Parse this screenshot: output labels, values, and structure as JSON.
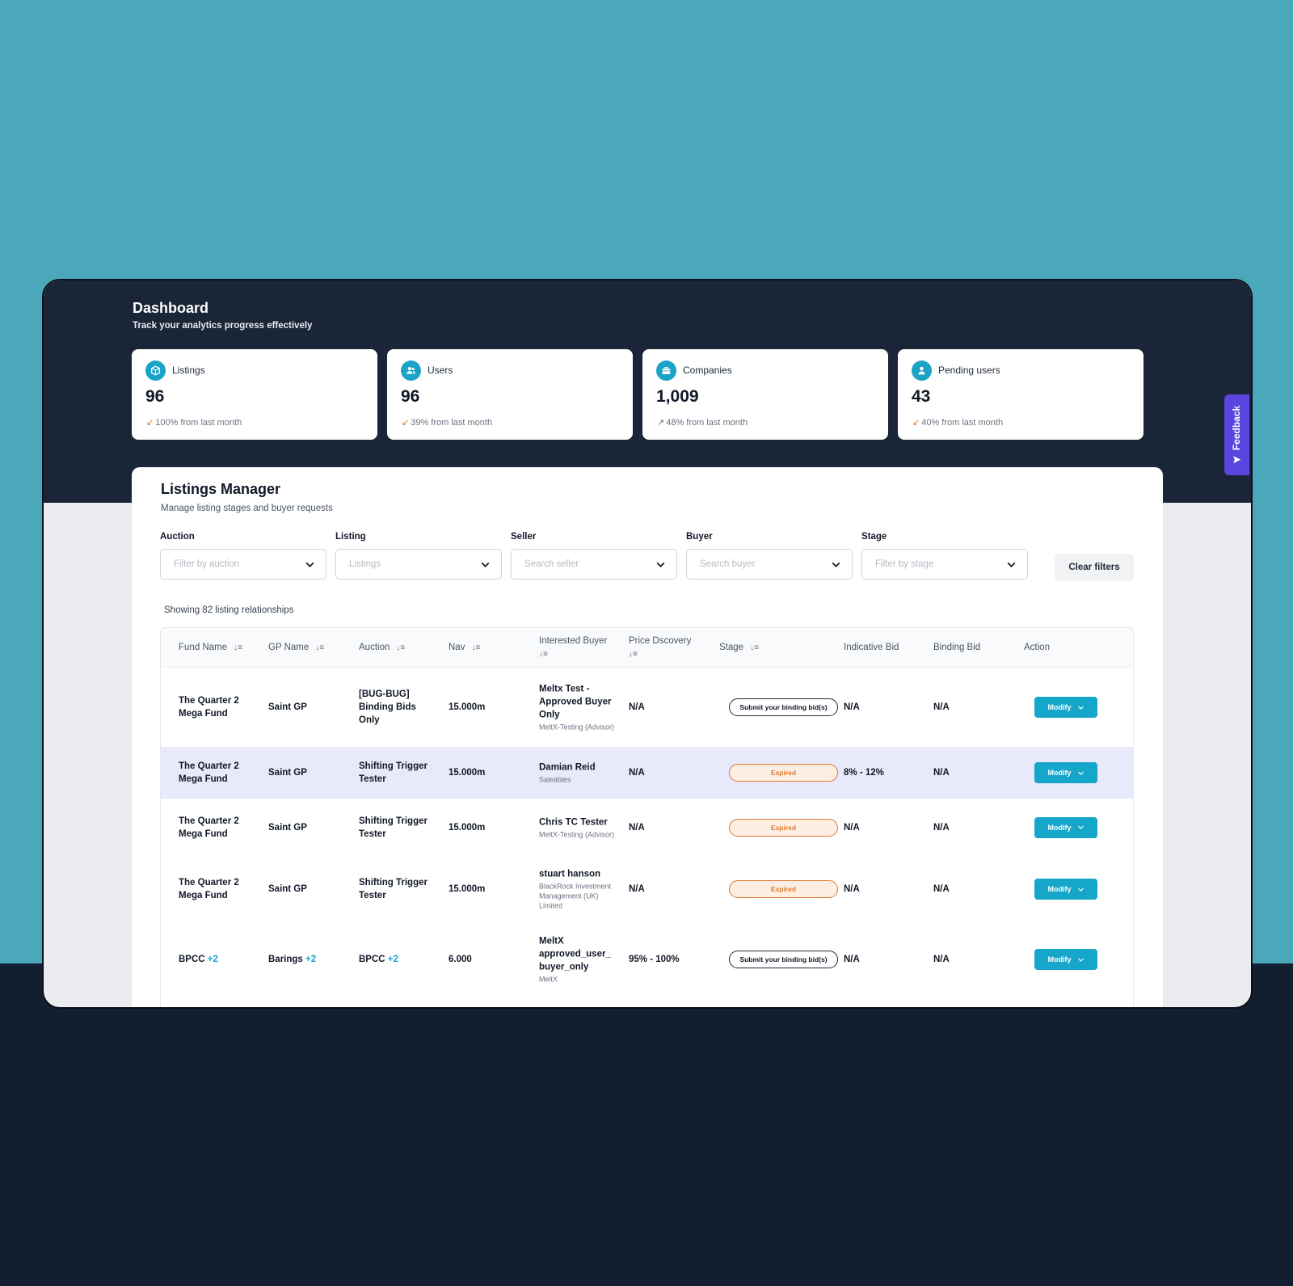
{
  "header": {
    "title": "Dashboard",
    "subtitle": "Track your analytics progress effectively"
  },
  "stats": [
    {
      "label": "Listings",
      "value": "96",
      "change": "100% from last month",
      "trend": "down",
      "icon": "box-icon"
    },
    {
      "label": "Users",
      "value": "96",
      "change": "39% from last month",
      "trend": "down",
      "icon": "users-icon"
    },
    {
      "label": "Companies",
      "value": "1,009",
      "change": "48% from last month",
      "trend": "up",
      "icon": "briefcase-icon"
    },
    {
      "label": "Pending users",
      "value": "43",
      "change": "40% from last month",
      "trend": "down",
      "icon": "user-icon"
    }
  ],
  "manager": {
    "title": "Listings Manager",
    "subtitle": "Manage listing stages and buyer requests",
    "filters": [
      {
        "label": "Auction",
        "placeholder": "Filter by auction"
      },
      {
        "label": "Listing",
        "placeholder": "Listings"
      },
      {
        "label": "Seller",
        "placeholder": "Search seller"
      },
      {
        "label": "Buyer",
        "placeholder": "Search buyer"
      },
      {
        "label": "Stage",
        "placeholder": "Filter by stage"
      }
    ],
    "clear_label": "Clear filters",
    "showing": "Showing 82 listing relationships"
  },
  "table": {
    "columns": {
      "fund_name": "Fund Name",
      "gp_name": "GP Name",
      "auction": "Auction",
      "nav": "Nav",
      "interested_buyer": "Interested Buyer",
      "price_discovery": "Price Dscovery",
      "stage": "Stage",
      "indicative_bid": "Indicative Bid",
      "binding_bid": "Binding Bid",
      "action": "Action"
    },
    "rows": [
      {
        "fund": "The Quarter 2 Mega Fund",
        "gp": "Saint GP",
        "auction": "[BUG-BUG] Binding Bids Only",
        "nav": "15.000m",
        "buyer": "Meltx Test - Approved Buyer Only",
        "buyer_org": "MeltX-Testing (Advisor)",
        "price": "N/A",
        "stage": "Submit your binding bid(s)",
        "indicative": "N/A",
        "binding": "N/A",
        "action": "Modify"
      },
      {
        "fund": "The Quarter 2 Mega Fund",
        "gp": "Saint GP",
        "auction": "Shifting Trigger Tester",
        "nav": "15.000m",
        "buyer": "Damian Reid",
        "buyer_org": "Saleables",
        "price": "N/A",
        "stage": "Expired",
        "indicative": "8% - 12%",
        "binding": "N/A",
        "action": "Modify"
      },
      {
        "fund": "The Quarter 2 Mega Fund",
        "gp": "Saint GP",
        "auction": "Shifting Trigger Tester",
        "nav": "15.000m",
        "buyer": "Chris TC Tester",
        "buyer_org": "MeltX-Testing (Advisor)",
        "price": "N/A",
        "stage": "Expired",
        "indicative": "N/A",
        "binding": "N/A",
        "action": "Modify"
      },
      {
        "fund": "The Quarter 2 Mega Fund",
        "gp": "Saint GP",
        "auction": "Shifting Trigger Tester",
        "nav": "15.000m",
        "buyer": "stuart hanson",
        "buyer_org": "BlackRock Investment Management (UK) Limited",
        "price": "N/A",
        "stage": "Expired",
        "indicative": "N/A",
        "binding": "N/A",
        "action": "Modify"
      },
      {
        "fund": "BPCC",
        "fund_extra": "+2",
        "gp": "Barings",
        "gp_extra": "+2",
        "auction": "BPCC",
        "auction_extra": "+2",
        "nav": "6.000",
        "buyer": "MeltX approved_user_ buyer_only",
        "buyer_org": "MeltX",
        "price": "95% - 100%",
        "stage": "Submit your binding bid(s)",
        "indicative": "N/A",
        "binding": "N/A",
        "action": "Modify"
      }
    ]
  },
  "feedback_label": "Feedback",
  "colors": {
    "background": "#4ba7ba",
    "header_dark": "#1a2637",
    "accent": "#1aa3c6",
    "expired": "#e07a2f",
    "feedback": "#5b45e0"
  }
}
